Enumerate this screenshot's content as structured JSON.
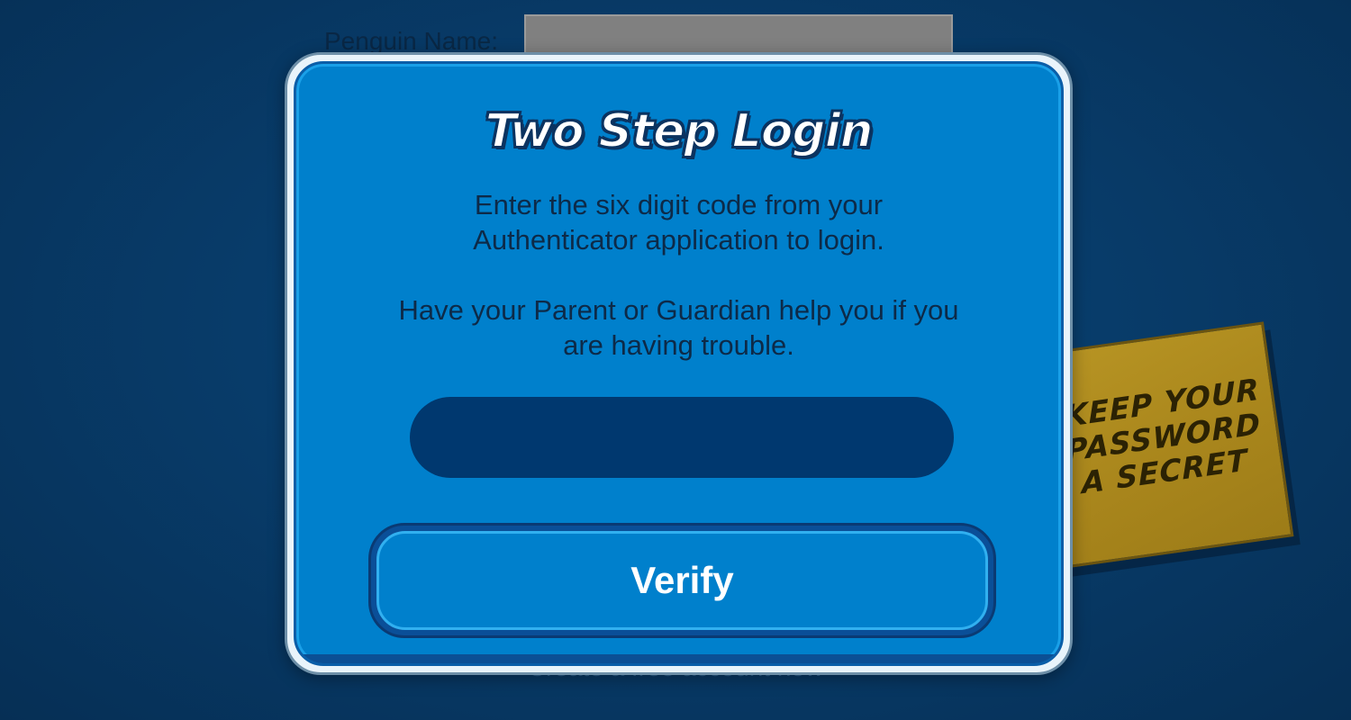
{
  "background_form": {
    "name_label": "Penguin Name:",
    "create_account_link": "Create a free account now"
  },
  "sticky_note": {
    "text": "KEEP YOUR PASSWORD A SECRET"
  },
  "modal": {
    "title": "Two Step Login",
    "instructions": "Enter the six digit code from your Authenticator application to login.",
    "help_text": "Have your Parent or Guardian help you if you are having trouble.",
    "code_input": {
      "value": "",
      "placeholder": ""
    },
    "verify_label": "Verify"
  },
  "colors": {
    "background": "#083c6a",
    "modal_panel": "#0080cc",
    "input_field": "#00386f",
    "sticky_note": "#b89524"
  }
}
